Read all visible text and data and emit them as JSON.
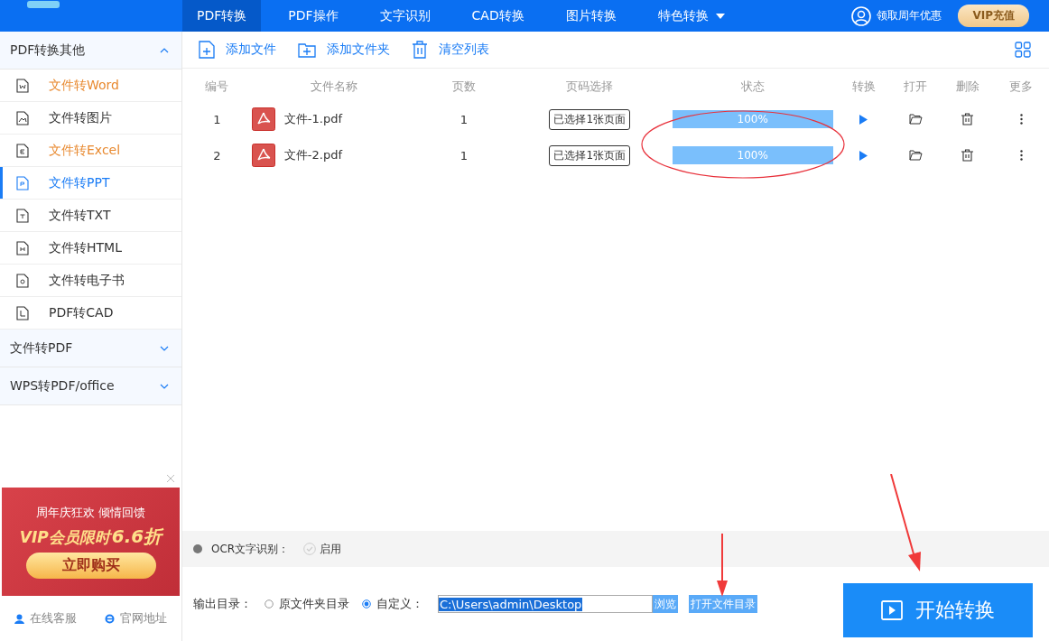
{
  "nav": {
    "tabs": [
      {
        "label": "PDF转换",
        "selected": true
      },
      {
        "label": "PDF操作",
        "selected": false
      },
      {
        "label": "文字识别",
        "selected": false
      },
      {
        "label": "CAD转换",
        "selected": false
      },
      {
        "label": "图片转换",
        "selected": false
      },
      {
        "label": "特色转换",
        "selected": false,
        "dropdown": true
      }
    ],
    "promo": "领取周年优惠",
    "vip": "VIP充值"
  },
  "sidebar": {
    "groups": [
      {
        "title": "PDF转换其他",
        "expanded": true,
        "items": [
          {
            "label": "文件转Word",
            "color": "#e8892f",
            "selected": false
          },
          {
            "label": "文件转图片",
            "color": "#333333",
            "selected": false
          },
          {
            "label": "文件转Excel",
            "color": "#e8892f",
            "selected": false
          },
          {
            "label": "文件转PPT",
            "color": "#1a7cf5",
            "selected": true
          },
          {
            "label": "文件转TXT",
            "color": "#333333",
            "selected": false
          },
          {
            "label": "文件转HTML",
            "color": "#333333",
            "selected": false
          },
          {
            "label": "文件转电子书",
            "color": "#333333",
            "selected": false
          },
          {
            "label": "PDF转CAD",
            "color": "#333333",
            "selected": false
          }
        ]
      },
      {
        "title": "文件转PDF",
        "expanded": false
      },
      {
        "title": "WPS转PDF/office",
        "expanded": false
      }
    ],
    "ad": {
      "line1": "周年庆狂欢 倾情回馈",
      "line2_a": "VIP会员限时",
      "line2_b": "6.6折",
      "button": "立即购买"
    },
    "links": [
      "在线客服",
      "官网地址"
    ]
  },
  "toolbar": [
    "添加文件",
    "添加文件夹",
    "清空列表"
  ],
  "table": {
    "columns": [
      "编号",
      "文件名称",
      "页数",
      "页码选择",
      "状态",
      "转换",
      "打开",
      "删除",
      "更多"
    ],
    "rows": [
      {
        "index": "1",
        "name": "文件-1.pdf",
        "pages": "1",
        "page_select": "已选择1张页面",
        "level": 1,
        "status": "100%"
      },
      {
        "index": "2",
        "name": "文件-2.pdf",
        "pages": "1",
        "page_select": "已选择1张页面",
        "level": 1,
        "status": "100%"
      }
    ]
  },
  "ocr": {
    "label": "OCR文字识别：",
    "option": "启用",
    "checked": false
  },
  "output": {
    "label": "输出目录：",
    "options": [
      {
        "label": "原文件夹目录",
        "selected": false
      },
      {
        "label": "自定义：",
        "selected": true
      }
    ],
    "path": "C:\\Users\\admin\\Desktop",
    "browse": "浏览",
    "open": "打开文件目录"
  },
  "start": "开始转换"
}
